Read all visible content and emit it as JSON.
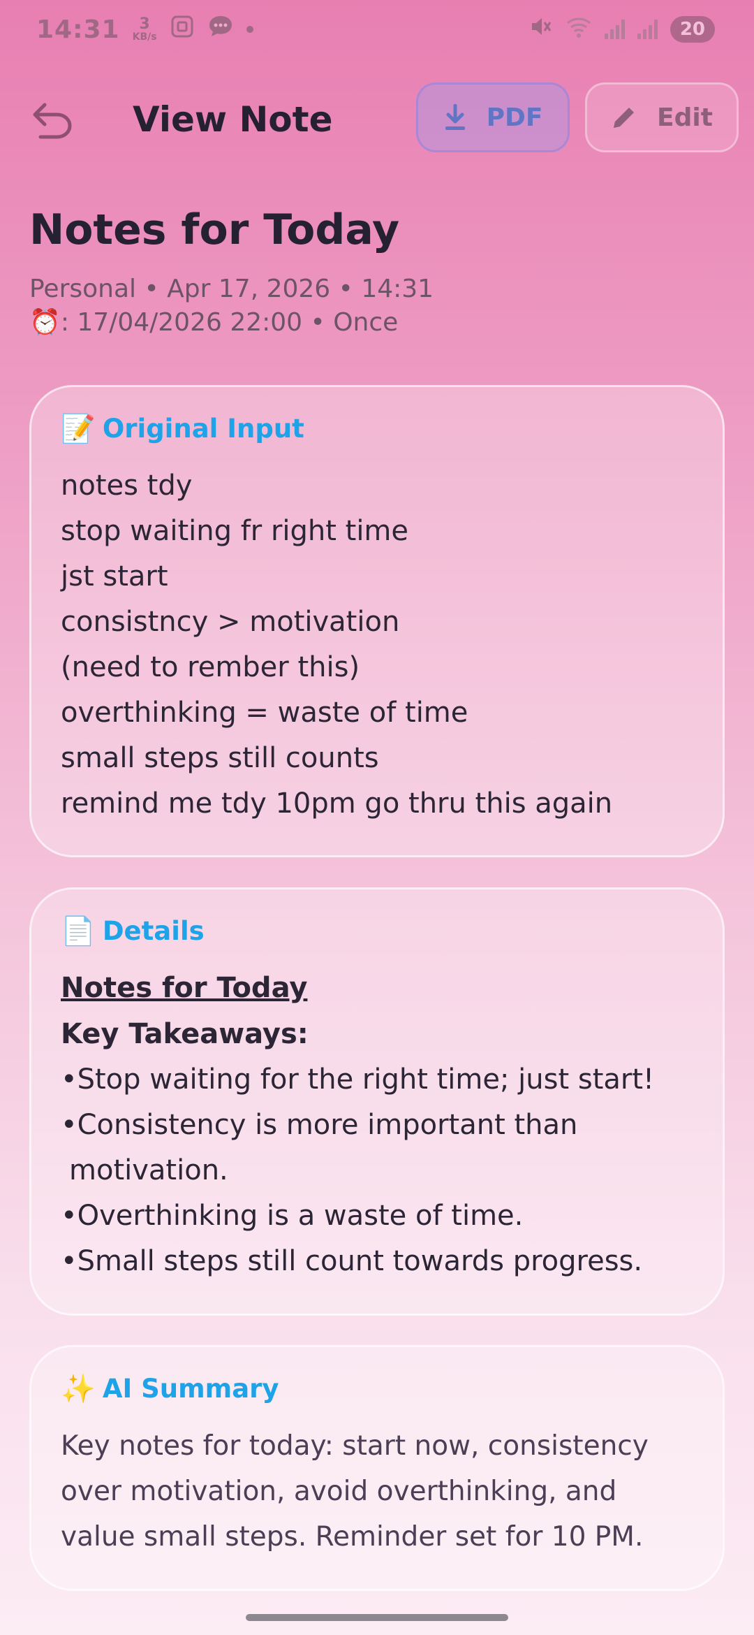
{
  "status_bar": {
    "time": "14:31",
    "net_speed": "3",
    "net_unit": "KB/s",
    "battery": "20",
    "colors": {
      "icon": "#a06884"
    }
  },
  "app_bar": {
    "title": "View Note",
    "pdf_label": "PDF",
    "edit_label": "Edit"
  },
  "note": {
    "title": "Notes for Today",
    "meta_line": "Personal • Apr 17, 2026 • 14:31",
    "reminder_icon": "⏰",
    "reminder_line": ": 17/04/2026 22:00 • Once"
  },
  "original_input": {
    "icon": "📝",
    "heading": "Original Input",
    "lines": [
      "notes tdy",
      "stop waiting fr right time",
      "jst start",
      "consistncy > motivation",
      "(need to rember this)",
      "overthinking = waste of time",
      "small steps still counts",
      "remind me tdy 10pm go thru this again"
    ]
  },
  "details": {
    "icon": "📄",
    "heading": "Details",
    "title": "Notes for Today",
    "subtitle": "Key Takeaways:",
    "bullets": [
      "Stop waiting for the right time; just start!",
      "Consistency is more important than motivation.",
      "Overthinking is a waste of time.",
      "Small steps still count towards progress."
    ]
  },
  "ai_summary": {
    "icon": "✨",
    "heading": "AI Summary",
    "text": "Key notes for today: start now, consistency over motivation, avoid overthinking, and value small steps. Reminder set for 10 PM."
  },
  "theme": {
    "accent": "#1ea3e8",
    "pdf_text": "#6275c4",
    "title_text": "#262033"
  }
}
